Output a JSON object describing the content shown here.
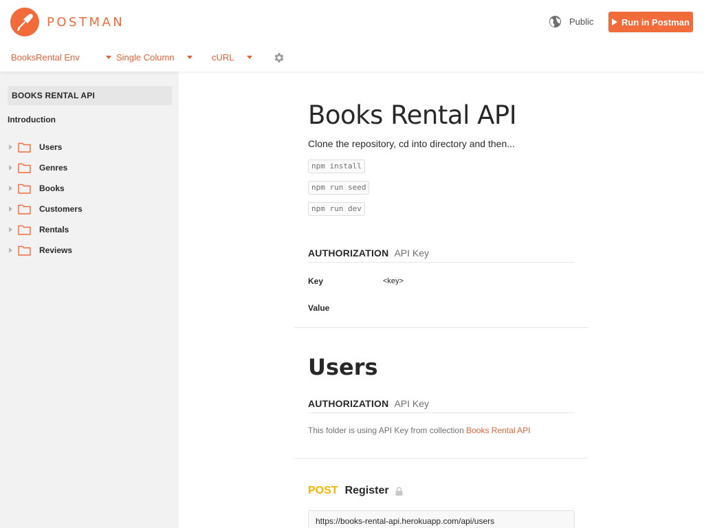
{
  "header": {
    "logo_text": "POSTMAN",
    "public_label": "Public",
    "run_button_label": "Run in Postman",
    "brand_color": "#f26b3a"
  },
  "toolbar": {
    "environment": "BooksRental Env",
    "layout": "Single Column",
    "language": "cURL"
  },
  "sidebar": {
    "collection_title": "BOOKS RENTAL API",
    "introduction": "Introduction",
    "folders": [
      {
        "label": "Users"
      },
      {
        "label": "Genres"
      },
      {
        "label": "Books"
      },
      {
        "label": "Customers"
      },
      {
        "label": "Rentals"
      },
      {
        "label": "Reviews"
      }
    ]
  },
  "main": {
    "title": "Books Rental API",
    "description": "Clone the repository, cd into directory and then...",
    "commands": [
      "npm install",
      "npm run seed",
      "npm run dev"
    ],
    "authorization": {
      "label": "AUTHORIZATION",
      "type": "API Key",
      "key_label": "Key",
      "key_value": "<key>",
      "value_label": "Value"
    },
    "users_section": {
      "title": "Users",
      "auth_label": "AUTHORIZATION",
      "auth_type": "API Key",
      "note_prefix": "This folder is using API Key from collection",
      "note_link": "Books Rental API"
    },
    "request": {
      "method": "POST",
      "name": "Register",
      "url": "https://books-rental-api.herokuapp.com/api/users"
    }
  }
}
